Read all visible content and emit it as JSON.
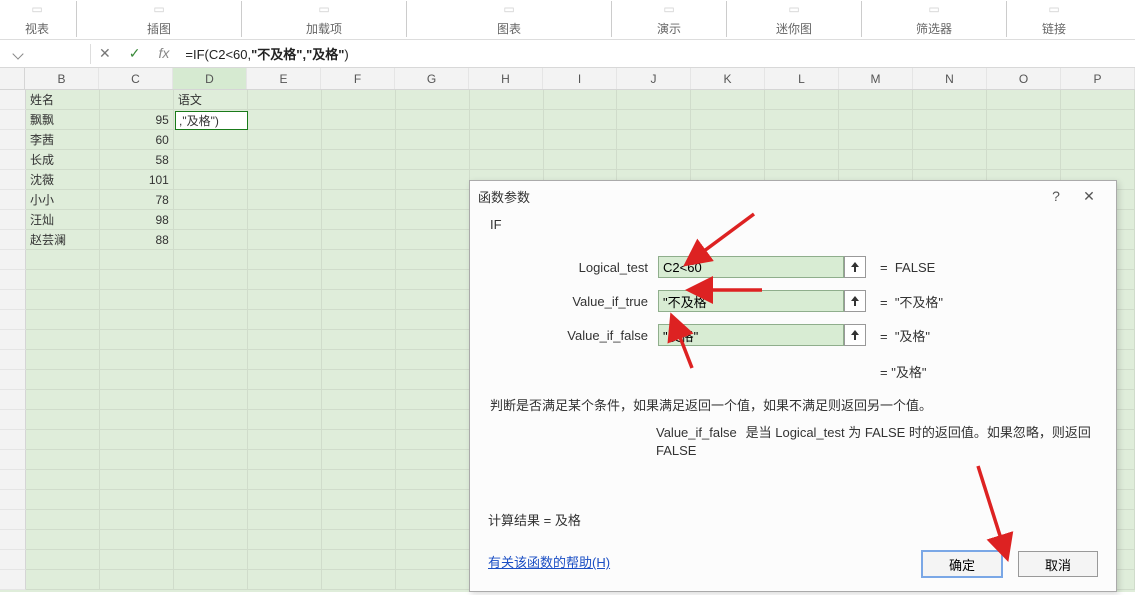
{
  "ribbon": {
    "groups": [
      "视表",
      "插图",
      "加载项",
      "图表",
      "演示",
      "迷你图",
      "筛选器",
      "链接"
    ],
    "widths": [
      74,
      160,
      160,
      200,
      110,
      130,
      140,
      90
    ]
  },
  "formula_bar": {
    "name_box": "",
    "cancel_glyph": "✕",
    "accept_glyph": "✓",
    "fx_label": "fx",
    "formula_plain_prefix": "=IF(C2<60,",
    "formula_bold": "\"不及格\",\"及格\"",
    "formula_plain_suffix": ")"
  },
  "columns": [
    "B",
    "C",
    "D",
    "E",
    "F",
    "G",
    "H",
    "I",
    "J",
    "K",
    "L",
    "M",
    "N",
    "O",
    "P"
  ],
  "active_col_index": 2,
  "rows": [
    {
      "b": "姓名",
      "c": "",
      "d": "语文"
    },
    {
      "b": "飘飘",
      "c": "95",
      "d": ""
    },
    {
      "b": "李茜",
      "c": "60",
      "d": ""
    },
    {
      "b": "长成",
      "c": "58",
      "d": ""
    },
    {
      "b": "沈薇",
      "c": "101",
      "d": ""
    },
    {
      "b": "小小",
      "c": "78",
      "d": ""
    },
    {
      "b": "汪灿",
      "c": "98",
      "d": ""
    },
    {
      "b": "赵芸澜",
      "c": "88",
      "d": ""
    }
  ],
  "selected_cell_display": ",\"及格\")",
  "dialog": {
    "title": "函数参数",
    "help_glyph": "?",
    "close_glyph": "✕",
    "func_name": "IF",
    "args": [
      {
        "label": "Logical_test",
        "value": "C2<60",
        "result": "FALSE"
      },
      {
        "label": "Value_if_true",
        "value": "\"不及格\"",
        "result": "\"不及格\""
      },
      {
        "label": "Value_if_false",
        "value": "\"及格\"",
        "result": "\"及格\""
      }
    ],
    "overall_prefix": "= ",
    "overall_result": "\"及格\"",
    "desc1": "判断是否满足某个条件，如果满足返回一个值，如果不满足则返回另一个值。",
    "desc2_label": "Value_if_false",
    "desc2_text": "是当 Logical_test 为 FALSE 时的返回值。如果忽略，则返回 FALSE",
    "calc_label": "计算结果 = ",
    "calc_value": "及格",
    "help_link": "有关该函数的帮助(H)",
    "ok": "确定",
    "cancel": "取消"
  }
}
